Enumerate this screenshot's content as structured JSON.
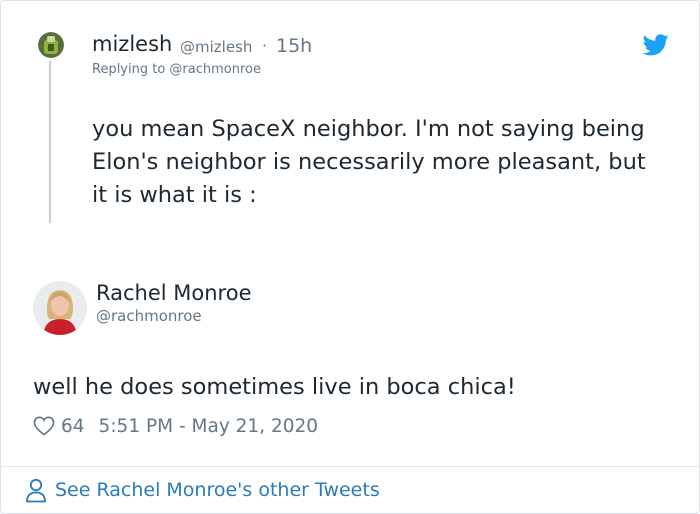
{
  "reply": {
    "name": "mizlesh",
    "handle": "@mizlesh",
    "separator": "·",
    "time": "15h",
    "replying_to": "Replying to @rachmonroe",
    "text": "you mean SpaceX neighbor. I'm not saying being Elon's neighbor is necessarily more pleasant, but it is what it is :"
  },
  "tweet": {
    "name": "Rachel Monroe",
    "handle": "@rachmonroe",
    "text": "well he does sometimes live in boca chica!",
    "likes": "64",
    "timestamp": "5:51 PM - May 21, 2020"
  },
  "footer": {
    "link_text": "See Rachel Monroe's other Tweets"
  },
  "colors": {
    "brand_blue": "#1da1f2",
    "link_blue": "#2b7bb9",
    "text_primary": "#1c2933",
    "text_secondary": "#657786"
  },
  "icons": {
    "brand": "twitter-bird-icon",
    "like": "heart-icon",
    "profile": "person-icon"
  }
}
